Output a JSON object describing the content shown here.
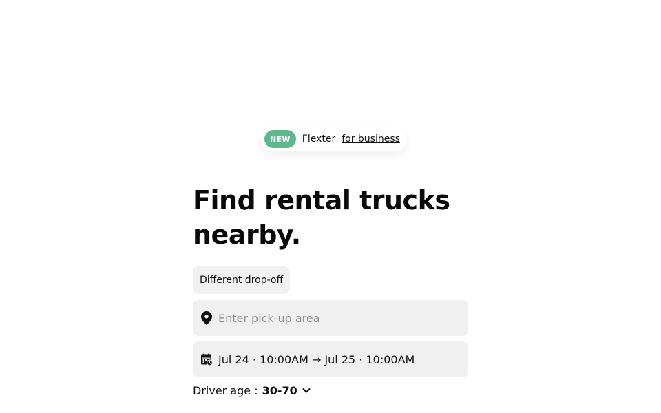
{
  "promo": {
    "badge": "NEW",
    "brand": "Flexter",
    "link": "for business",
    "badge_color": "#5fb88d"
  },
  "hero": {
    "title": "Find rental trucks nearby."
  },
  "search": {
    "dropoff_chip": "Different drop-off",
    "pickup_placeholder": "Enter pick-up area",
    "pickup_value": "",
    "pickup_icon": "map-pin-icon",
    "dates_icon": "calendar-clock-icon",
    "dates_text": "Jul 24 · 10:00AM → Jul 25 · 10:00AM",
    "field_bg": "#f0f0f0"
  },
  "driver_age": {
    "label": "Driver age :",
    "value": "30-70",
    "icon": "chevron-down-icon"
  }
}
